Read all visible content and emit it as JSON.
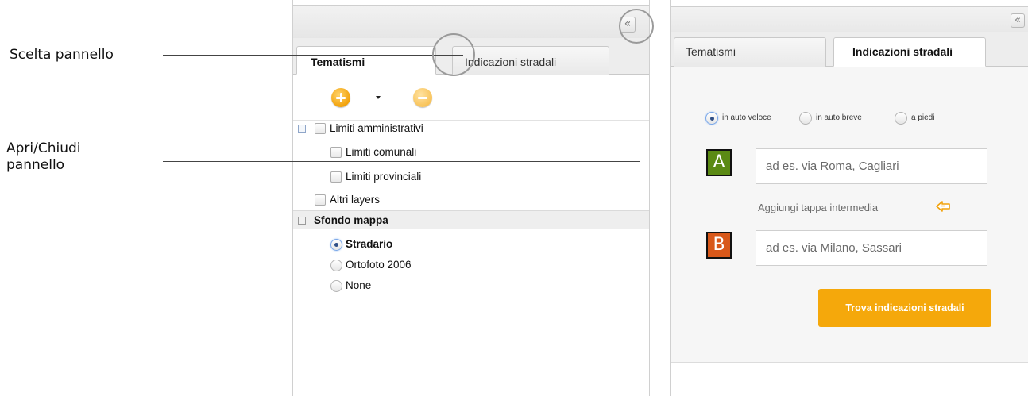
{
  "annotations": {
    "panel_choice": "Scelta pannello",
    "toggle_panel_line1": "Apri/Chiudi",
    "toggle_panel_line2": "pannello"
  },
  "collapse_icon": "«",
  "left_panel": {
    "tabs": [
      {
        "label": "Tematismi",
        "state": "active"
      },
      {
        "label": "Indicazioni stradali",
        "state": "inactive"
      }
    ],
    "toolbar": {
      "add_icon": "plus-circle-icon",
      "menu_icon": "caret-down-icon",
      "remove_icon": "minus-circle-icon"
    },
    "tree": {
      "admin_group": "Limiti amministrativi",
      "municipal": "Limiti comunali",
      "provincial": "Limiti provinciali",
      "other_layers": "Altri layers",
      "basemap_group": "Sfondo mappa",
      "basemaps": [
        {
          "label": "Stradario",
          "selected": true
        },
        {
          "label": "Ortofoto 2006",
          "selected": false
        },
        {
          "label": "None",
          "selected": false
        }
      ]
    }
  },
  "right_panel": {
    "tabs": [
      {
        "label": "Tematismi",
        "state": "inactive"
      },
      {
        "label": "Indicazioni stradali",
        "state": "active"
      }
    ],
    "modes": [
      {
        "label": "in auto veloce",
        "selected": true
      },
      {
        "label": "in auto breve",
        "selected": false
      },
      {
        "label": "a piedi",
        "selected": false
      }
    ],
    "start": {
      "letter": "A",
      "placeholder": "ad es. via Roma, Cagliari"
    },
    "end": {
      "letter": "B",
      "placeholder": "ad es. via Milano, Sassari"
    },
    "add_stop": "Aggiungi tappa intermedia",
    "add_stop_icon": "add-stop-arrow-icon",
    "submit": "Trova indicazioni stradali"
  },
  "colors": {
    "accent_orange": "#f5a80b",
    "marker_a": "#5b8a14",
    "marker_b": "#d8581a"
  }
}
